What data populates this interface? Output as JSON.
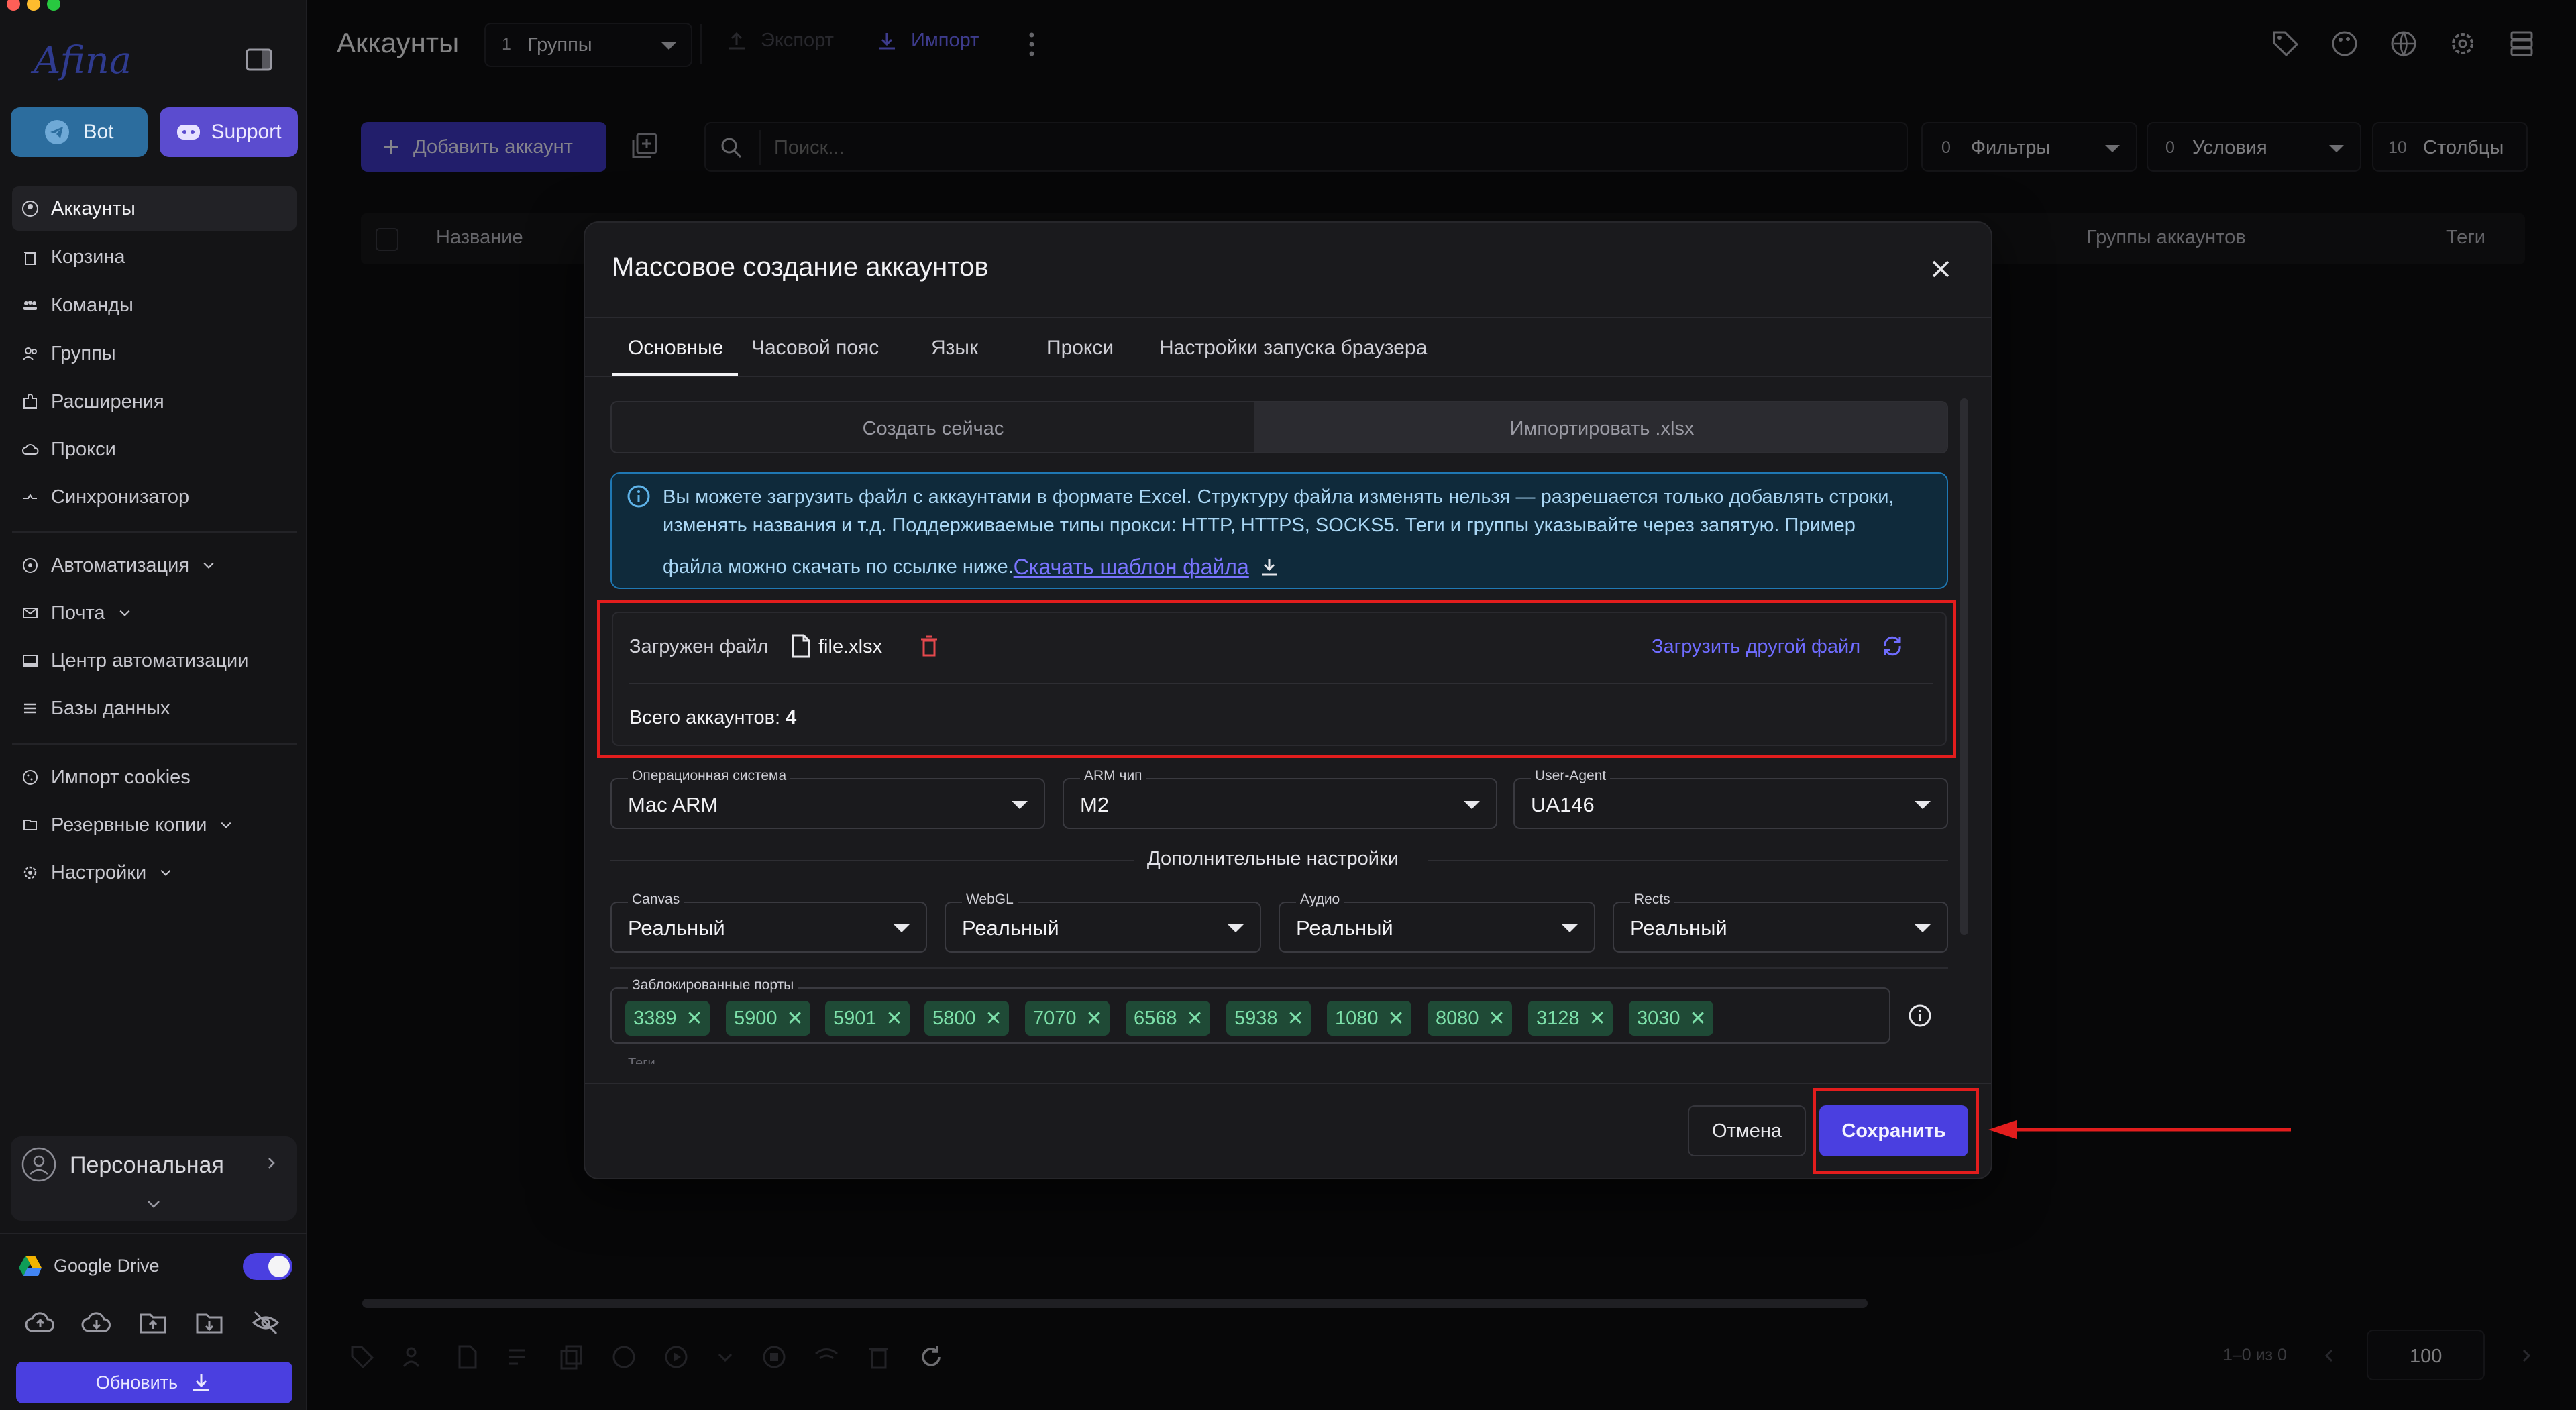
{
  "app": {
    "logo_text": "Afina"
  },
  "sidebar": {
    "bot_label": "Bot",
    "support_label": "Support",
    "items": [
      {
        "label": "Аккаунты"
      },
      {
        "label": "Корзина"
      },
      {
        "label": "Команды"
      },
      {
        "label": "Группы"
      },
      {
        "label": "Расширения"
      },
      {
        "label": "Прокси"
      },
      {
        "label": "Синхронизатор"
      },
      {
        "label": "Автоматизация"
      },
      {
        "label": "Почта"
      },
      {
        "label": "Центр автоматизации"
      },
      {
        "label": "Базы данных"
      },
      {
        "label": "Импорт cookies"
      },
      {
        "label": "Резервные копии"
      },
      {
        "label": "Настройки"
      }
    ],
    "profile_label": "Персональная",
    "google_drive_label": "Google Drive",
    "update_label": "Обновить"
  },
  "header": {
    "title": "Аккаунты",
    "groups_count": "1",
    "groups_label": "Группы",
    "export_label": "Экспорт",
    "import_label": "Импорт"
  },
  "toolbar": {
    "add_account_label": "Добавить аккаунт",
    "search_placeholder": "Поиск...",
    "filters_count": "0",
    "filters_label": "Фильтры",
    "conditions_count": "0",
    "conditions_label": "Условия",
    "columns_count": "10",
    "columns_label": "Столбцы"
  },
  "table": {
    "col_name": "Название",
    "col_account_groups": "Группы аккаунтов",
    "col_tags": "Теги"
  },
  "pagination": {
    "range_text": "1–0 из 0",
    "page_size": "100"
  },
  "modal": {
    "title": "Массовое создание аккаунтов",
    "tabs": [
      {
        "label": "Основные"
      },
      {
        "label": "Часовой пояс"
      },
      {
        "label": "Язык"
      },
      {
        "label": "Прокси"
      },
      {
        "label": "Настройки запуска браузера"
      }
    ],
    "mode_create": "Создать сейчас",
    "mode_import": "Импортировать .xlsx",
    "info_line1": "Вы можете загрузить файл с аккаунтами в формате Excel. Структуру файла изменять нельзя — разрешается только добавлять строки,",
    "info_line2": "изменять названия и т.д. Поддерживаемые типы прокси: HTTP, HTTPS, SOCKS5. Теги и группы указывайте через запятую. Пример",
    "info_line3": "файла можно скачать по ссылке ниже.",
    "info_link": "Скачать шаблон файла",
    "uploaded_label": "Загружен файл",
    "file_name": "file.xlsx",
    "upload_other_label": "Загрузить другой файл",
    "total_label": "Всего аккаунтов:",
    "total_value": "4",
    "os": {
      "label": "Операционная система",
      "value": "Mac ARM"
    },
    "arm": {
      "label": "ARM чип",
      "value": "M2"
    },
    "ua": {
      "label": "User-Agent",
      "value": "UA146"
    },
    "additional_settings": "Дополнительные настройки",
    "canvas": {
      "label": "Canvas",
      "value": "Реальный"
    },
    "webgl": {
      "label": "WebGL",
      "value": "Реальный"
    },
    "audio": {
      "label": "Аудио",
      "value": "Реальный"
    },
    "rects": {
      "label": "Rects",
      "value": "Реальный"
    },
    "blocked_ports_label": "Заблокированные порты",
    "ports": [
      "3389",
      "5900",
      "5901",
      "5800",
      "7070",
      "6568",
      "5938",
      "1080",
      "8080",
      "3128",
      "3030"
    ],
    "tags_label_partial": "Теги",
    "cancel_label": "Отмена",
    "save_label": "Сохранить"
  },
  "colors": {
    "accent": "#4a3fe0",
    "link": "#6f6cff",
    "danger": "#e5484d",
    "annotation_red": "#e21d1d",
    "info_bg": "#0f2a3b",
    "chip_bg": "#1f4a36"
  }
}
